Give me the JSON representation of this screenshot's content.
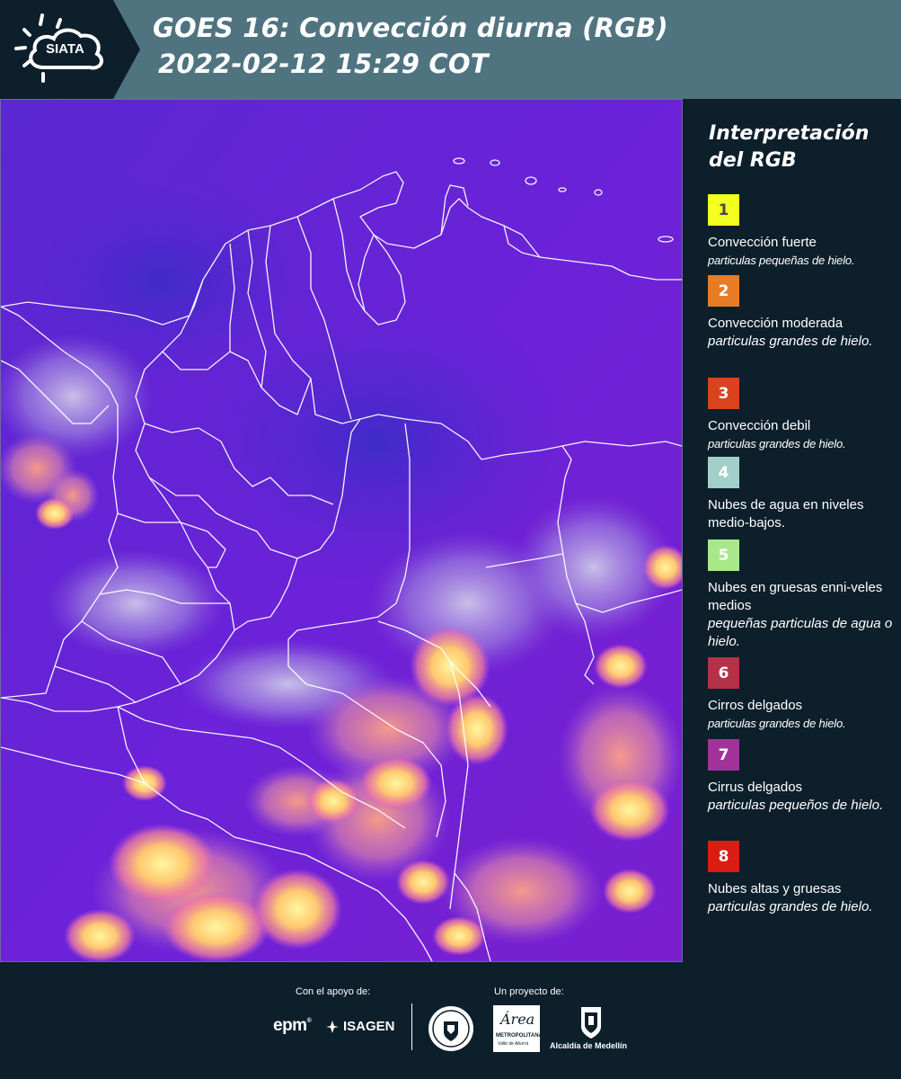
{
  "header": {
    "logo_text": "SIATA",
    "title_line1": "GOES 16: Convección diurna (RGB)",
    "title_line2": "2022-02-12 15:29 COT",
    "background_color": "#4f7480"
  },
  "map": {
    "product": "Convección diurna (RGB)",
    "region": "Colombia",
    "base_color": "#6a1fd6",
    "boundary_color": "#ffffff"
  },
  "legend": {
    "title_line1": "Interpretación",
    "title_line2": "del RGB",
    "items": [
      {
        "number": "1",
        "color": "#f4ff1f",
        "number_color": "#4a4a4a",
        "label": "Convección fuerte",
        "sub": "particulas pequeñas de hielo."
      },
      {
        "number": "2",
        "color": "#e87b25",
        "number_color": "#ffffff",
        "label": "Convección moderada",
        "sub": "particulas grandes de hielo."
      },
      {
        "number": "3",
        "color": "#d9431e",
        "number_color": "#ffffff",
        "label": "Convección debil",
        "sub": "particulas grandes de hielo."
      },
      {
        "number": "4",
        "color": "#a2cfc9",
        "number_color": "#ffffff",
        "label": "Nubes de agua en niveles medio-bajos.",
        "sub": ""
      },
      {
        "number": "5",
        "color": "#a8e88a",
        "number_color": "#ffffff",
        "label": "Nubes en gruesas enni-veles medios",
        "sub": "pequeñas particulas de agua o hielo."
      },
      {
        "number": "6",
        "color": "#b5314a",
        "number_color": "#ffffff",
        "label": "Cirros delgados",
        "sub": "particulas grandes de hielo."
      },
      {
        "number": "7",
        "color": "#a0329a",
        "number_color": "#ffffff",
        "label": "Cirrus delgados",
        "sub": "particulas pequeños de hielo."
      },
      {
        "number": "8",
        "color": "#d91d14",
        "number_color": "#ffffff",
        "label": "Nubes altas y gruesas",
        "sub": "particulas grandes de hielo."
      }
    ]
  },
  "footer": {
    "support_caption": "Con el apoyo de:",
    "project_caption": "Un proyecto de:",
    "epm_logo_text": "epm",
    "isagen_logo_text": "ISAGEN",
    "area_logo_word": "Área",
    "area_logo_line1": "METROPOLITANA",
    "area_logo_line2": "Valle de Aburrá",
    "alcaldia_text": "Alcaldía de Medellín"
  }
}
